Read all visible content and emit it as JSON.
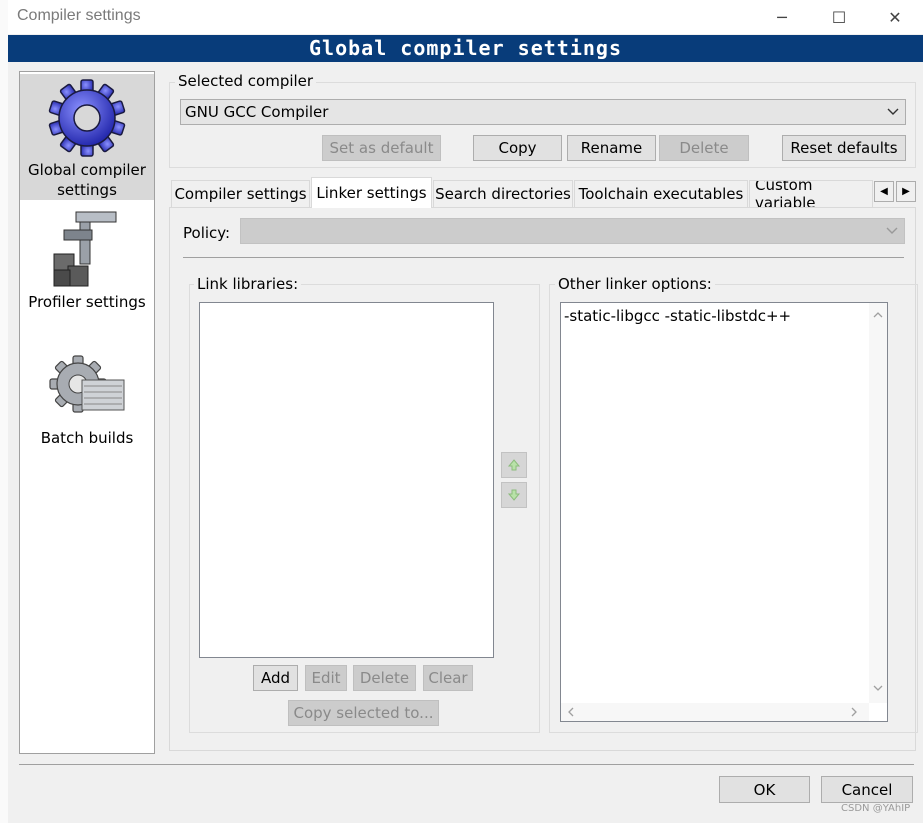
{
  "window": {
    "title": "Compiler settings",
    "banner": "Global compiler settings",
    "controls": {
      "minimize": "─",
      "maximize": "☐",
      "close": "✕"
    }
  },
  "sidebar": {
    "items": [
      {
        "label_line1": "Global compiler",
        "label_line2": "settings",
        "icon": "gear-icon",
        "selected": true
      },
      {
        "label_line1": "Profiler settings",
        "icon": "caliper-icon",
        "selected": false
      },
      {
        "label_line1": "Batch builds",
        "icon": "batch-gear-icon",
        "selected": false
      }
    ]
  },
  "compiler": {
    "group_title": "Selected compiler",
    "selected": "GNU GCC Compiler",
    "buttons": {
      "set_default": "Set as default",
      "copy": "Copy",
      "rename": "Rename",
      "delete": "Delete",
      "reset": "Reset defaults"
    }
  },
  "tabs": [
    {
      "label": "Compiler settings",
      "active": false
    },
    {
      "label": "Linker settings",
      "active": true
    },
    {
      "label": "Search directories",
      "active": false
    },
    {
      "label": "Toolchain executables",
      "active": false
    },
    {
      "label": "Custom variable",
      "active": false
    }
  ],
  "linker": {
    "policy_label": "Policy:",
    "policy_value": "",
    "libraries_title": "Link libraries:",
    "libraries": [],
    "lib_buttons": {
      "add": "Add",
      "edit": "Edit",
      "delete": "Delete",
      "clear": "Clear",
      "copy_to": "Copy selected to..."
    },
    "other_title": "Other linker options:",
    "other_options": "-static-libgcc -static-libstdc++"
  },
  "footer": {
    "ok": "OK",
    "cancel": "Cancel",
    "watermark": "CSDN @YAhIP"
  },
  "colors": {
    "banner_bg": "#083c7a",
    "dialog_bg": "#f0f0f0",
    "gear_blue": "#3a3fd6"
  }
}
